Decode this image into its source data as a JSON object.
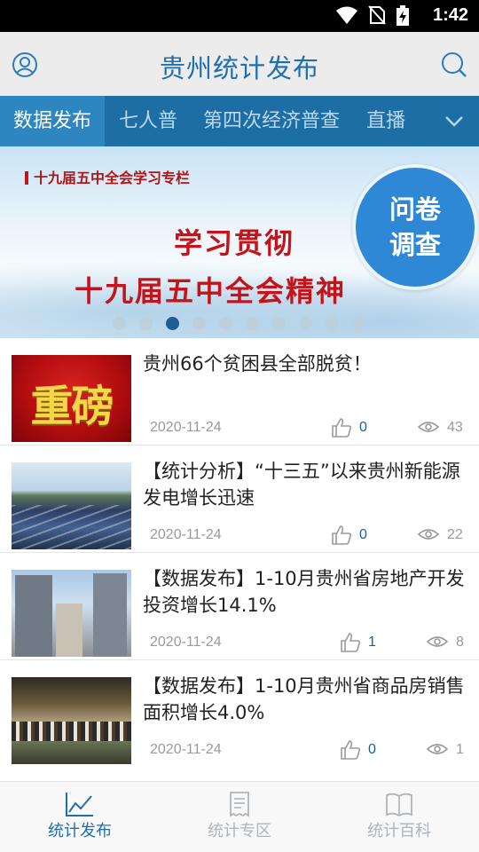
{
  "status_bar": {
    "time": "1:42",
    "icons": [
      "wifi-icon",
      "no-sim-icon",
      "battery-charging-icon"
    ]
  },
  "header": {
    "title": "贵州统计发布",
    "left_icon": "user-icon",
    "right_icon": "search-icon"
  },
  "tabs": [
    {
      "label": "数据发布",
      "active": true
    },
    {
      "label": "七人普",
      "active": false
    },
    {
      "label": "第四次经济普查",
      "active": false
    },
    {
      "label": "直播",
      "active": false
    }
  ],
  "banner": {
    "tag": "十九届五中全会学习专栏",
    "line1": "学习贯彻",
    "line2": "十九届五中全会精神",
    "slide_count": 10,
    "active_slide": 3,
    "survey_button": [
      "问卷",
      "调查"
    ]
  },
  "news": [
    {
      "title": "贵州66个贫困县全部脱贫！",
      "thumb_text": "重磅",
      "thumb": "headline-graphic",
      "date": "2020-11-24",
      "likes": "0",
      "views": "43"
    },
    {
      "title": "【统计分析】“十三五”以来贵州新能源发电增长迅速",
      "thumb": "solar-panels-photo",
      "date": "2020-11-24",
      "likes": "0",
      "views": "22"
    },
    {
      "title": "【数据发布】1-10月贵州省房地产开发投资增长14.1%",
      "thumb": "construction-photo",
      "date": "2020-11-24",
      "likes": "1",
      "views": "8"
    },
    {
      "title": "【数据发布】1-10月贵州省商品房销售面积增长4.0%",
      "thumb": "sales-hall-photo",
      "date": "2020-11-24",
      "likes": "0",
      "views": "1"
    }
  ],
  "bottom_nav": [
    {
      "label": "统计发布",
      "icon": "line-chart-icon",
      "active": true
    },
    {
      "label": "统计专区",
      "icon": "receipt-icon",
      "active": false
    },
    {
      "label": "统计百科",
      "icon": "book-icon",
      "active": false
    }
  ],
  "colors": {
    "brand_blue": "#1f6fae",
    "tab_bar": "#1e6ea6",
    "tab_active": "#2e86c1",
    "survey_button": "#2f88d6",
    "banner_red": "#c4141b"
  }
}
